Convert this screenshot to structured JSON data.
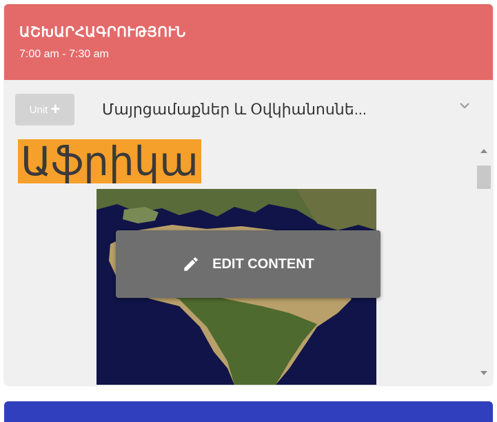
{
  "header": {
    "title": "ԱՇԽԱՐՀԱԳՐՈՒԹՅՈՒՆ",
    "time": "7:00 am - 7:30 am",
    "bg_color": "#e46a6a"
  },
  "unit": {
    "button_label": "Unit",
    "button_icon": "plus-icon",
    "title": "Մայրցամաքներ և Օվկիանոսնե...",
    "toggle_icon": "chevron-down-icon"
  },
  "content": {
    "heading": "Աֆրիկա",
    "heading_bg": "#f5a02a",
    "image": "africa-satellite-map",
    "overlay_label": "EDIT CONTENT",
    "overlay_icon": "pencil-icon"
  },
  "next_card_color": "#2f3fbd"
}
